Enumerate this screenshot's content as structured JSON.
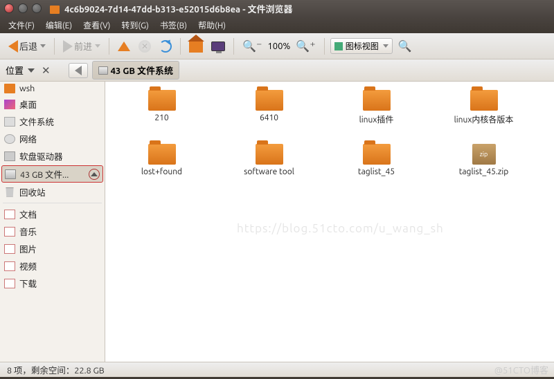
{
  "window": {
    "title": "4c6b9024-7d14-47dd-b313-e52015d6b8ea - 文件浏览器"
  },
  "menubar": {
    "items": [
      "文件(F)",
      "编辑(E)",
      "查看(V)",
      "转到(G)",
      "书签(B)",
      "帮助(H)"
    ]
  },
  "toolbar": {
    "back": "后退",
    "forward": "前进",
    "zoom_level": "100%",
    "view_mode": "图标视图"
  },
  "location": {
    "panel_label": "位置",
    "path_button": "43 GB 文件系统"
  },
  "sidebar": {
    "items": [
      {
        "label": "wsh",
        "icon": "fld"
      },
      {
        "label": "桌面",
        "icon": "dsk"
      },
      {
        "label": "文件系统",
        "icon": "fs"
      },
      {
        "label": "网络",
        "icon": "net"
      },
      {
        "label": "软盘驱动器",
        "icon": "floppy"
      },
      {
        "label": "43 GB 文件...",
        "icon": "hdd",
        "selected": true,
        "eject": true
      },
      {
        "label": "回收站",
        "icon": "trash"
      },
      {
        "label": "文档",
        "icon": "doc"
      },
      {
        "label": "音乐",
        "icon": "mus"
      },
      {
        "label": "图片",
        "icon": "pic"
      },
      {
        "label": "视频",
        "icon": "vid"
      },
      {
        "label": "下载",
        "icon": "dl"
      }
    ]
  },
  "files": [
    {
      "name": "210",
      "type": "folder"
    },
    {
      "name": "6410",
      "type": "folder"
    },
    {
      "name": "linux插件",
      "type": "folder"
    },
    {
      "name": "linux内核各版本",
      "type": "folder"
    },
    {
      "name": "lost+found",
      "type": "folder"
    },
    {
      "name": "software tool",
      "type": "folder"
    },
    {
      "name": "taglist_45",
      "type": "folder"
    },
    {
      "name": "taglist_45.zip",
      "type": "zip"
    }
  ],
  "statusbar": {
    "text": "8 项，剩余空间：22.8 GB"
  },
  "watermark": "@51CTO博客",
  "bg_watermark": "https://blog.51cto.com/u_wang_sh"
}
